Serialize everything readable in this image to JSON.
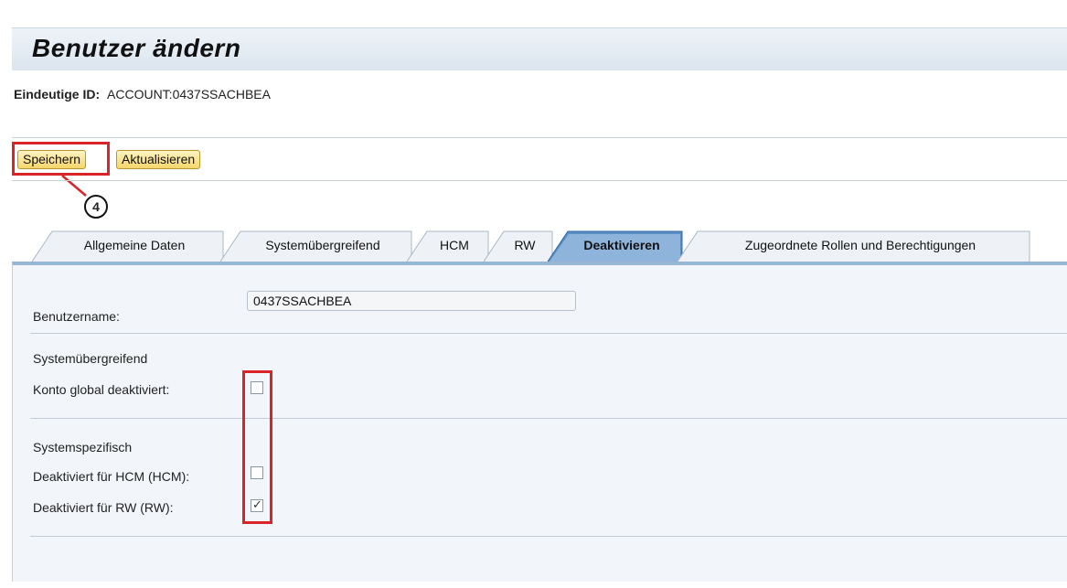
{
  "page": {
    "title": "Benutzer ändern",
    "unique_id_label": "Eindeutige ID:",
    "unique_id_value": "ACCOUNT:0437SSACHBEA"
  },
  "toolbar": {
    "save_label": "Speichern",
    "refresh_label": "Aktualisieren"
  },
  "annotation": {
    "step_number": "4",
    "highlight_color": "#d9252a"
  },
  "tabs": [
    {
      "label": "Allgemeine Daten",
      "active": false
    },
    {
      "label": "Systemübergreifend",
      "active": false
    },
    {
      "label": "HCM",
      "active": false
    },
    {
      "label": "RW",
      "active": false
    },
    {
      "label": "Deaktivieren",
      "active": true
    },
    {
      "label": "Zugeordnete Rollen und Berechtigungen",
      "active": false
    }
  ],
  "form": {
    "username_label": "Benutzername:",
    "username_value": "0437SSACHBEA",
    "cross_system_heading": "Systemübergreifend",
    "global_deactivated_label": "Konto global deaktiviert:",
    "global_deactivated_checked": false,
    "system_specific_heading": "Systemspezifisch",
    "hcm_deactivated_label": "Deaktiviert für HCM (HCM):",
    "hcm_deactivated_checked": false,
    "rw_deactivated_label": "Deaktiviert für RW (RW):",
    "rw_deactivated_checked": true
  },
  "colors": {
    "active_tab": "#2f6aa6",
    "inactive_tab": "#eef2f6",
    "button": "#f5d66a",
    "content_bg": "#f2f5f9"
  }
}
